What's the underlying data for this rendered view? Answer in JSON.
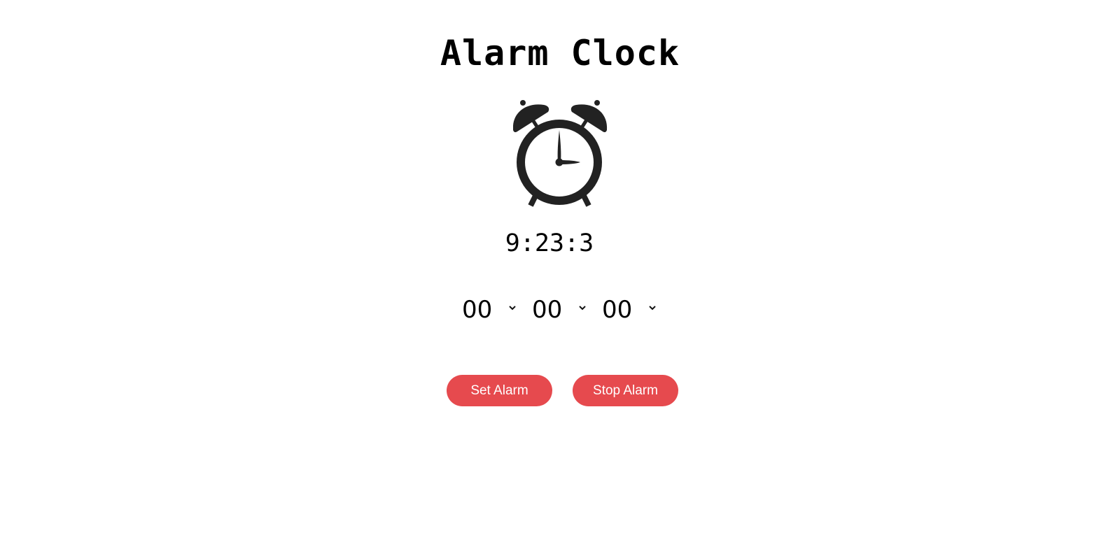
{
  "page": {
    "title": "Alarm Clock"
  },
  "clock": {
    "icon": "alarm-clock-icon",
    "current_time": "9:23:3"
  },
  "alarm_selects": {
    "hour": {
      "value": "00"
    },
    "minute": {
      "value": "00"
    },
    "second": {
      "value": "00"
    },
    "arrow_icon": "chevron-down-icon"
  },
  "buttons": {
    "set_label": "Set Alarm",
    "stop_label": "Stop Alarm"
  },
  "colors": {
    "accent": "#e64a4e",
    "icon": "#222222",
    "text": "#000000",
    "background": "#ffffff"
  }
}
